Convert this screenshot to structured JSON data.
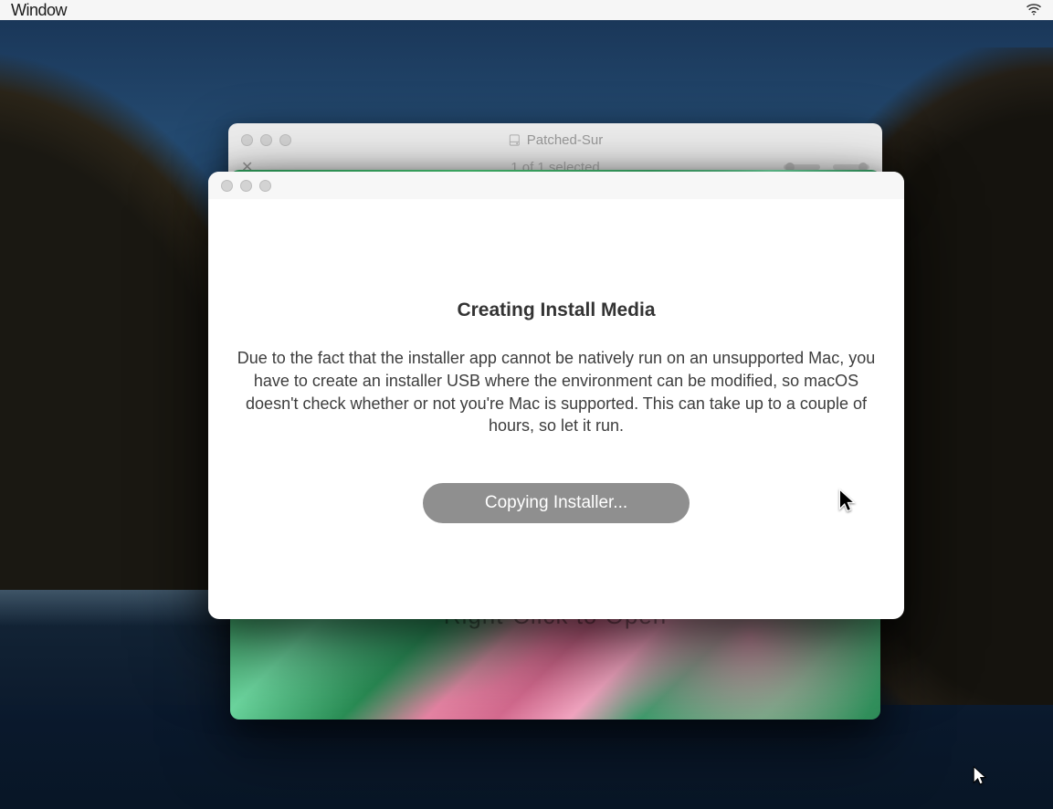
{
  "menubar": {
    "menu_item": "Window"
  },
  "finder": {
    "title": "Patched-Sur",
    "selection": "1 of 1 selected"
  },
  "dialog": {
    "heading": "Creating Install Media",
    "body": "Due to the fact that the installer app cannot be natively run on an unsupported Mac, you have to create an installer USB where the environment can be modified, so macOS doesn't check whether or not you're Mac is supported. This can take up to a couple of hours, so let it run.",
    "button_label": "Copying Installer..."
  },
  "color_window": {
    "peek_text": "Right-Click to Open"
  }
}
